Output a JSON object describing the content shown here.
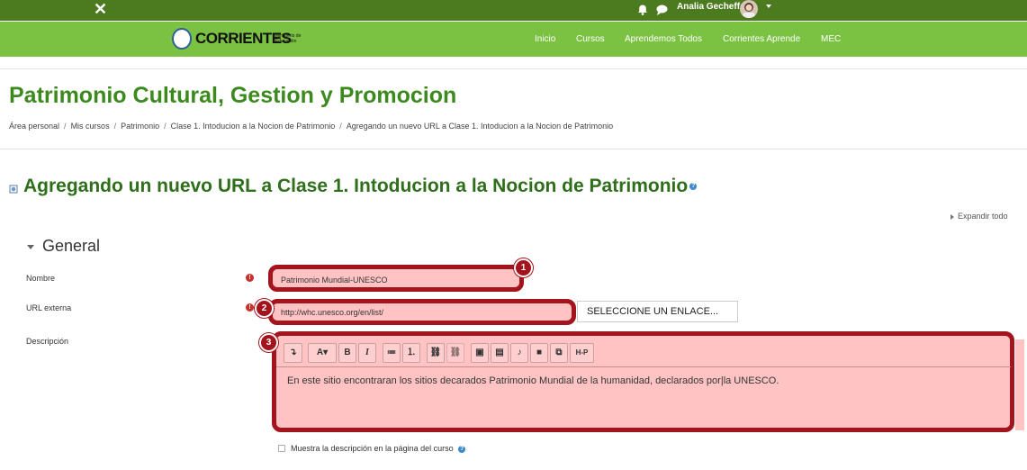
{
  "topbar": {
    "close_label": "✕",
    "user_name": "Analia Gecheff"
  },
  "brand": {
    "name": "CORRIENTES",
    "ministry": "Ministerio de Educación"
  },
  "nav": {
    "items": [
      "Inicio",
      "Cursos",
      "Aprendemos Todos",
      "Corrientes Aprende",
      "MEC"
    ]
  },
  "page": {
    "title": "Patrimonio Cultural, Gestion y Promocion",
    "breadcrumb": [
      "Área personal",
      "Mis cursos",
      "Patrimonio",
      "Clase 1. Intoducion a la Nocion de Patrimonio",
      "Agregando un nuevo URL a Clase 1. Intoducion a la Nocion de Patrimonio"
    ],
    "breadcrumb_sep": "/",
    "heading": "Agregando un nuevo URL a Clase 1. Intoducion a la Nocion de Patrimonio",
    "help_glyph": "?",
    "expand_all": "Expandir todo"
  },
  "form": {
    "section": "General",
    "nombre_label": "Nombre",
    "nombre_value": "Patrimonio Mundial-UNESCO",
    "url_label": "URL externa",
    "url_value": "http://whc.unesco.org/en/list/",
    "select_link": "SELECCIONE UN ENLACE...",
    "descripcion_label": "Descripción",
    "descripcion_value": "En este sitio encontraran los sitios decarados Patrimonio Mundial de la humanidad, declarados por|la UNESCO.",
    "show_description": "Muestra la descripción en la página del curso",
    "required_glyph": "!"
  },
  "toolbar": {
    "buttons": [
      "↴",
      "A▾",
      "B",
      "I",
      "≔",
      "⒈",
      "⛓",
      "⛓",
      "▣",
      "▤",
      "♪",
      "■",
      "⧉",
      "H-P"
    ]
  },
  "annotations": [
    "1",
    "2",
    "3"
  ],
  "colors": {
    "topbar": "#4c7a1f",
    "navbar": "#7cc242",
    "heading": "#3c8a1e",
    "highlight_border": "#a3141d",
    "highlight_fill": "#ffc3c4"
  }
}
